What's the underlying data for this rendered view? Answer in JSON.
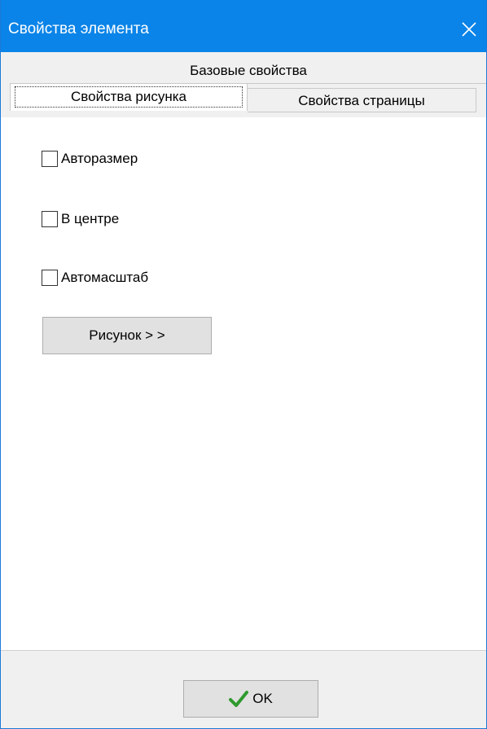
{
  "window": {
    "title": "Свойства элемента"
  },
  "tabs": {
    "base": "Базовые свойства",
    "picture": "Свойства рисунка",
    "page": "Свойства страницы"
  },
  "options": {
    "autosize": {
      "label": "Авторазмер",
      "checked": false
    },
    "center": {
      "label": "В центре",
      "checked": false
    },
    "autoscale": {
      "label": "Автомасштаб",
      "checked": false
    }
  },
  "buttons": {
    "picture": "Рисунок > >",
    "ok": "OK"
  },
  "colors": {
    "titlebar": "#0a84e8",
    "ok_check": "#2f9a2f"
  },
  "icons": {
    "close": "close-icon",
    "ok": "checkmark-icon"
  }
}
